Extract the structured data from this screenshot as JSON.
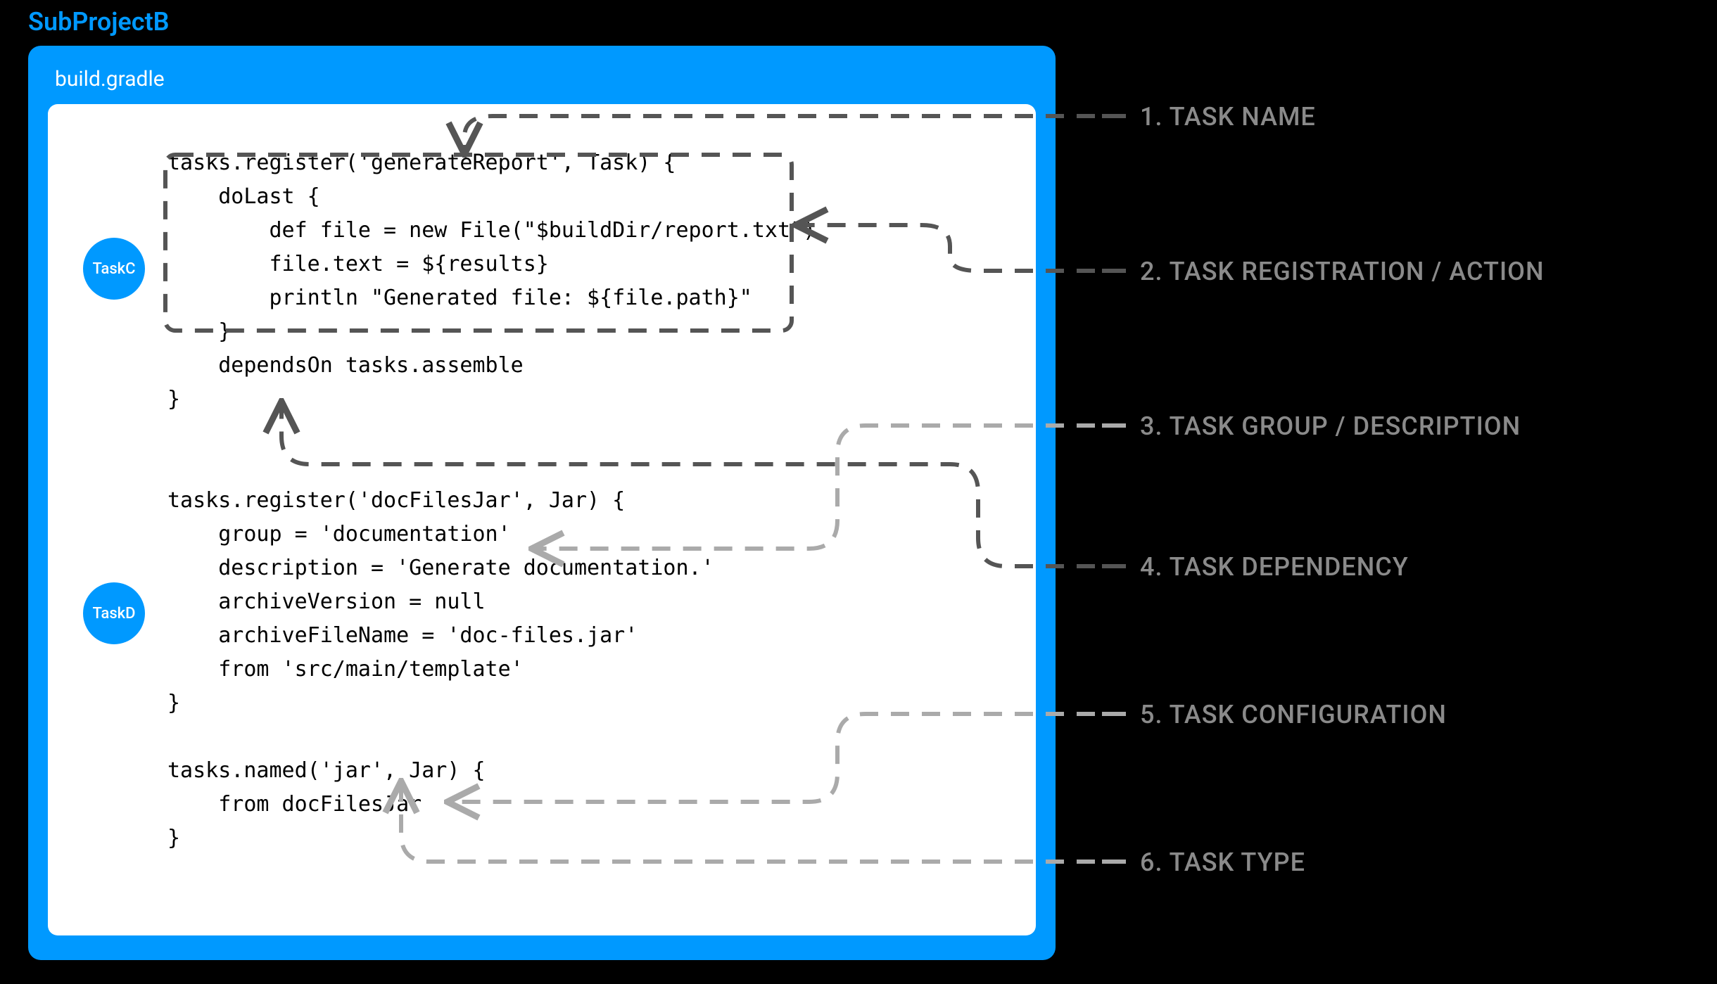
{
  "project": {
    "title": "SubProjectB"
  },
  "file": {
    "name": "build.gradle"
  },
  "tasks": {
    "c_label": "TaskC",
    "d_label": "TaskD"
  },
  "code": {
    "block": "tasks.register('generateReport', Task) {\n    doLast {\n        def file = new File(\"$buildDir/report.txt\")\n        file.text = ${results}\n        println \"Generated file: ${file.path}\"\n    }\n    dependsOn tasks.assemble\n}\n\n\ntasks.register('docFilesJar', Jar) {\n    group = 'documentation'\n    description = 'Generate documentation.'\n    archiveVersion = null\n    archiveFileName = 'doc-files.jar'\n    from 'src/main/template'\n}\n\ntasks.named('jar', Jar) {\n    from docFilesJar\n}"
  },
  "annotations": {
    "a1": "1.  TASK NAME",
    "a2": "2.  TASK REGISTRATION / ACTION",
    "a3": "3.  TASK GROUP / DESCRIPTION",
    "a4": "4.  TASK DEPENDENCY",
    "a5": "5.  TASK CONFIGURATION",
    "a6": "6.  TASK TYPE"
  },
  "colors": {
    "brand_blue": "#0099ff",
    "anno_gray": "#8a8a8a",
    "dash_dark": "#555555",
    "dash_light": "#aaaaaa"
  }
}
